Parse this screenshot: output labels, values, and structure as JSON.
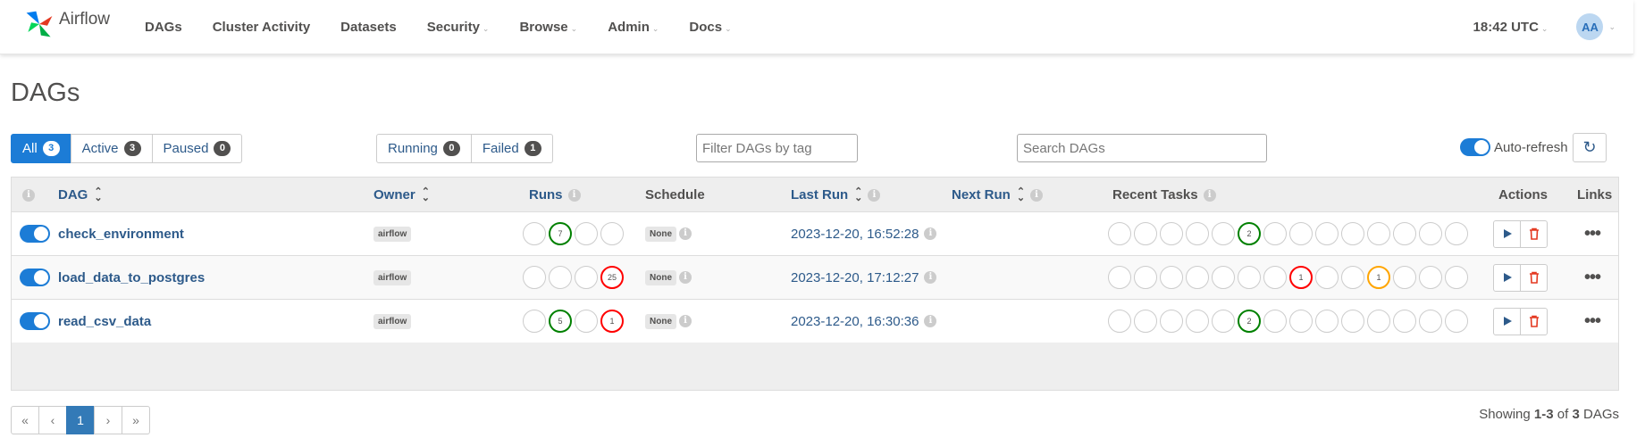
{
  "navbar": {
    "brand": "Airflow",
    "items": [
      {
        "label": "DAGs",
        "dropdown": false
      },
      {
        "label": "Cluster Activity",
        "dropdown": false
      },
      {
        "label": "Datasets",
        "dropdown": false
      },
      {
        "label": "Security",
        "dropdown": true
      },
      {
        "label": "Browse",
        "dropdown": true
      },
      {
        "label": "Admin",
        "dropdown": true
      },
      {
        "label": "Docs",
        "dropdown": true
      }
    ],
    "time": "18:42 UTC",
    "avatar": "AA"
  },
  "page": {
    "title": "DAGs"
  },
  "status_filter": [
    {
      "label": "All",
      "count": "3",
      "active": true
    },
    {
      "label": "Active",
      "count": "3",
      "active": false
    },
    {
      "label": "Paused",
      "count": "0",
      "active": false
    }
  ],
  "run_filter": [
    {
      "label": "Running",
      "count": "0"
    },
    {
      "label": "Failed",
      "count": "1"
    }
  ],
  "tag_filter": {
    "placeholder": "Filter DAGs by tag"
  },
  "search": {
    "placeholder": "Search DAGs"
  },
  "auto_refresh": {
    "label": "Auto-refresh",
    "on": true
  },
  "table": {
    "headers": {
      "dag": "DAG",
      "owner": "Owner",
      "runs": "Runs",
      "schedule": "Schedule",
      "last_run": "Last Run",
      "next_run": "Next Run",
      "recent_tasks": "Recent Tasks",
      "actions": "Actions",
      "links": "Links"
    },
    "rows": [
      {
        "dag_id": "check_environment",
        "owner": "airflow",
        "runs": [
          {
            "n": "",
            "s": ""
          },
          {
            "n": "7",
            "s": "green"
          },
          {
            "n": "",
            "s": ""
          },
          {
            "n": "",
            "s": ""
          }
        ],
        "schedule": "None",
        "last_run": "2023-12-20, 16:52:28",
        "tasks": [
          "",
          "",
          "",
          "",
          "",
          "2",
          "",
          "",
          "",
          "",
          "",
          "",
          "",
          ""
        ],
        "task_states": [
          "",
          "",
          "",
          "",
          "",
          "green",
          "",
          "",
          "",
          "",
          "",
          "",
          "",
          ""
        ]
      },
      {
        "dag_id": "load_data_to_postgres",
        "owner": "airflow",
        "runs": [
          {
            "n": "",
            "s": ""
          },
          {
            "n": "",
            "s": ""
          },
          {
            "n": "",
            "s": ""
          },
          {
            "n": "25",
            "s": "red"
          }
        ],
        "schedule": "None",
        "last_run": "2023-12-20, 17:12:27",
        "tasks": [
          "",
          "",
          "",
          "",
          "",
          "",
          "",
          "1",
          "",
          "",
          "1",
          "",
          "",
          ""
        ],
        "task_states": [
          "",
          "",
          "",
          "",
          "",
          "",
          "",
          "red",
          "",
          "",
          "orange",
          "",
          "",
          ""
        ]
      },
      {
        "dag_id": "read_csv_data",
        "owner": "airflow",
        "runs": [
          {
            "n": "",
            "s": ""
          },
          {
            "n": "5",
            "s": "green"
          },
          {
            "n": "",
            "s": ""
          },
          {
            "n": "1",
            "s": "red"
          }
        ],
        "schedule": "None",
        "last_run": "2023-12-20, 16:30:36",
        "tasks": [
          "",
          "",
          "",
          "",
          "",
          "2",
          "",
          "",
          "",
          "",
          "",
          "",
          "",
          ""
        ],
        "task_states": [
          "",
          "",
          "",
          "",
          "",
          "green",
          "",
          "",
          "",
          "",
          "",
          "",
          "",
          ""
        ]
      }
    ]
  },
  "pagination": {
    "pages": [
      "«",
      "‹",
      "1",
      "›",
      "»"
    ],
    "current": "1"
  },
  "summary": {
    "prefix": "Showing ",
    "range": "1-3",
    "mid": " of ",
    "total": "3",
    "suffix": " DAGs"
  }
}
